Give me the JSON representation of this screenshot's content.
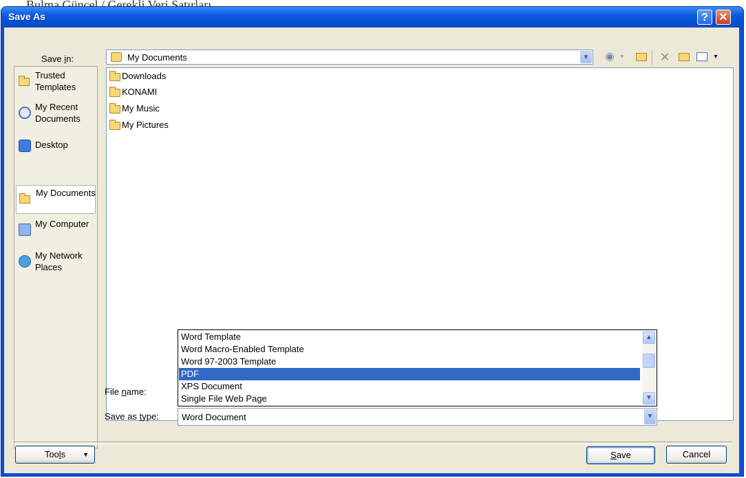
{
  "background_doc_text": "Bulma Güncel / Gerekli Veri Satırları",
  "dialog": {
    "title": "Save As",
    "help_label": "?",
    "close_label": "✕"
  },
  "save_in": {
    "label_pre": "Save ",
    "label_u": "i",
    "label_post": "n:",
    "value": "My Documents"
  },
  "places": [
    {
      "label": "Trusted Templates",
      "icon": "folder-icon"
    },
    {
      "label": "My Recent Documents",
      "icon": "recent-documents-icon"
    },
    {
      "label": "Desktop",
      "icon": "desktop-icon"
    },
    {
      "label": "My Documents",
      "icon": "my-documents-icon",
      "selected": true
    },
    {
      "label": "My Computer",
      "icon": "computer-icon"
    },
    {
      "label": "My Network Places",
      "icon": "network-places-icon"
    }
  ],
  "files": [
    {
      "name": "Downloads",
      "icon": "folder-icon"
    },
    {
      "name": "KONAMI",
      "icon": "folder-icon"
    },
    {
      "name": "My Music",
      "icon": "music-folder-icon"
    },
    {
      "name": "My Pictures",
      "icon": "pictures-folder-icon"
    }
  ],
  "file_name": {
    "label_pre": "File ",
    "label_u": "n",
    "label_post": "ame:",
    "value": ""
  },
  "save_as_type": {
    "label_pre": "Save as ",
    "label_u": "t",
    "label_post": "ype:",
    "value": "Word Document",
    "open_options": [
      "Word Template",
      "Word Macro-Enabled Template",
      "Word 97-2003 Template",
      "PDF",
      "XPS Document",
      "Single File Web Page"
    ],
    "highlighted": "PDF"
  },
  "buttons": {
    "tools_pre": "Too",
    "tools_u": "l",
    "tools_post": "s",
    "save_u": "S",
    "save_post": "ave",
    "cancel": "Cancel"
  },
  "colors": {
    "title_blue": "#0a4fd6",
    "dialog_face": "#ece9d8",
    "selection": "#316ac5"
  }
}
